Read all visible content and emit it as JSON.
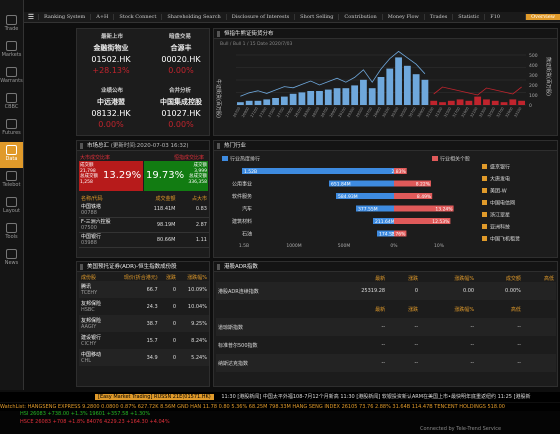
{
  "nav": {
    "items": [
      "Ranking System",
      "A+H",
      "Stock Connect",
      "Shareholding Search",
      "Disclosure of Interests",
      "Short Selling",
      "Contribution",
      "Money Flow",
      "Trades",
      "Statistic",
      "F10"
    ],
    "active": "Overview"
  },
  "rail": [
    "Trade",
    "Markets",
    "Warrants",
    "CBBC",
    "Futures",
    "Data",
    "Telebot",
    "Layout",
    "Trade",
    "News"
  ],
  "rail_labels": [
    "Trade",
    "Markets",
    "Warrants",
    "CBBC",
    "Futures",
    "Data",
    "Telebot",
    "Layout",
    "Tools",
    "News"
  ],
  "hotstocks": {
    "cat1": "最新上市",
    "cat2": "暗盘交易",
    "cat3": "业绩公布",
    "cat4": "合并分析",
    "items": [
      {
        "name": "金融街物业",
        "code": "01502.HK",
        "pct": "+28.13%"
      },
      {
        "name": "合源丰",
        "code": "00020.HK",
        "pct": "0.00%"
      },
      {
        "name": "中远港盟",
        "code": "08132.HK",
        "pct": "0.00%"
      },
      {
        "name": "中国集成控股",
        "code": "01027.HK",
        "pct": "0.00%"
      }
    ]
  },
  "rank_chart": {
    "title": "恒指牛熊证街货分布",
    "legend": "Bull / Bull  1 / 15 Date 2020/7/03",
    "left_axis": "牛证街货(百万股)",
    "right_axis": "熊证街货(百万股)",
    "y_right": [
      "500",
      "400",
      "300",
      "200",
      "100",
      "0"
    ]
  },
  "flow": {
    "title": "市场总汇",
    "time": "(更新时间:2020-07-03 16:32)",
    "left_title": "大市成交比率",
    "right_title": "恒指成交比率",
    "left_stats": {
      "r1": "成交额",
      "v1": "21,798",
      "r2": "总成交额",
      "v2": "1,258"
    },
    "left_pct": "13.29%",
    "right_pct": "19.73%",
    "right_stats": {
      "r1": "成交额",
      "v1": "3,999",
      "r2": "总成交额",
      "v2": "336,358"
    },
    "headers": [
      "名称/代码",
      "成交金额",
      "占大市"
    ],
    "rows": [
      {
        "name": "中国铁塔",
        "code": "00788",
        "amt": "118.41M",
        "pct": "0.83"
      },
      {
        "name": "F-三洲六控股",
        "code": "07500",
        "amt": "98.19M",
        "pct": "2.87"
      },
      {
        "name": "中国银行",
        "code": "03988",
        "amt": "80.66M",
        "pct": "1.11"
      }
    ]
  },
  "hot": {
    "title": "热门行业",
    "left_legend": "行业热度排行",
    "right_legend": "行业相关个股",
    "sectors": [
      {
        "name": "银行",
        "l": "1.52B",
        "r": "2.83%"
      },
      {
        "name": "公用事业",
        "l": "651.84M",
        "r": "8.22%"
      },
      {
        "name": "软件服务",
        "l": "584.93M",
        "r": "8.49%"
      },
      {
        "name": "汽车",
        "l": "377.55M",
        "r": "13.24%"
      },
      {
        "name": "建筑材料",
        "l": "211.64M",
        "r": "12.53%"
      },
      {
        "name": "石油",
        "l": "174.55M",
        "r": "2.76%"
      }
    ],
    "axis": [
      "1.5B",
      "1000M",
      "500M",
      "0%",
      "10%"
    ],
    "stocks": [
      "盛京银行",
      "大唐发电",
      "美团-W",
      "中国电信网",
      "浙江翠星",
      "亚洲科技",
      "中国飞机租赁"
    ]
  },
  "adr": {
    "title": "美国预托证券(ADR)-恒生指数成份股",
    "headers": [
      "成份股",
      "现价(折合港元)",
      "涨跌",
      "涨跌幅%"
    ],
    "rows": [
      {
        "name": "腾讯",
        "code": "TCEHY",
        "price": "66.7",
        "chg": "0",
        "pct": "10.09%"
      },
      {
        "name": "友邦保险",
        "code": "HSBC",
        "price": "24.3",
        "pct": "10.04%",
        "chg": "0"
      },
      {
        "name": "友邦保险",
        "code": "AAGIY",
        "price": "38.7",
        "chg": "0",
        "pct": "9.25%"
      },
      {
        "name": "建设银行",
        "code": "CICHY",
        "price": "15.7",
        "chg": "0",
        "pct": "8.24%"
      },
      {
        "name": "中国移动",
        "code": "CHL",
        "price": "34.9",
        "chg": "0",
        "pct": "5.24%"
      }
    ]
  },
  "adr_index": {
    "title": "港股ADR指数",
    "headers": [
      "最新",
      "涨跌",
      "涨跌幅%",
      "成交额",
      "高低"
    ],
    "rows": [
      {
        "name": "港股ADR连续指数",
        "last": "25319.28",
        "chg": "0",
        "pct": "0.00",
        "vol": "0.00%"
      },
      {
        "name": "",
        "last": "最新",
        "chg": "涨跌",
        "pct": "涨跌幅%",
        "vol": "高低"
      },
      {
        "name": "道琼斯指数",
        "last": "--",
        "chg": "--",
        "pct": "--",
        "vol": "--"
      },
      {
        "name": "标准普尔500指数",
        "last": "--",
        "chg": "--",
        "pct": "--",
        "vol": "--"
      },
      {
        "name": "纳斯达克指数",
        "last": "--",
        "chg": "--",
        "pct": "--",
        "vol": "--"
      }
    ]
  },
  "news": {
    "tag": "[Easy Market Trading] RUSSN 21E(01571.HK)",
    "items": "11:30 [港股新闻] 中国太平外福108-7月12个月新高    11:30 [港股新闻] 软银投资新认ARM在美国上市•最快明年底重返纽约    11:25 [港股新"
  },
  "ticker": "WatchList:  HANGSENG EXPRESS 9.2800  0.0800  0.87%  627.72K  8.56M   GND HAN  11.78  0.80  5.36%  68.25M  798.33M   HANG SENG INDEX  26105  73.76  2.88%  31.64B  114.47B   TENCENT HOLDINGS  518.00",
  "indices": {
    "r1": "HSI  26083  +738.00  +1.3%  19601  +357.58  +1.30%",
    "r2": "HSCE  26083  +708  +1.8%  84076  4229.23  +164.30  +4.04%",
    "r3": "Connected by Tele-Trend Service"
  }
}
